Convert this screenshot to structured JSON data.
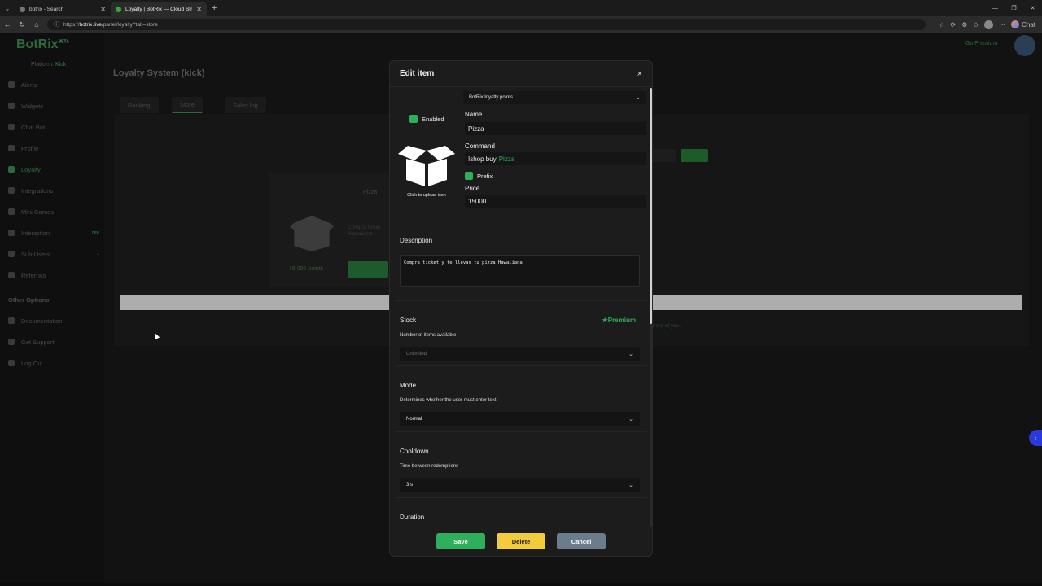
{
  "browser": {
    "tabs": [
      {
        "title": "botrix - Search",
        "active": false
      },
      {
        "title": "Loyalty | BotRix — Cloud Streaming",
        "active": true
      }
    ],
    "url_prefix": "https://",
    "url_host": "botrix.live",
    "url_path": "/panel/loyalty?tab=store",
    "chat_label": "Chat"
  },
  "sidebar": {
    "logo": "BotRix",
    "logo_tag": "BETA",
    "platform_label": "Platform:",
    "platform_value": "Kick",
    "items": [
      {
        "label": "Alerts"
      },
      {
        "label": "Widgets"
      },
      {
        "label": "Chat Bot"
      },
      {
        "label": "Profile"
      },
      {
        "label": "Loyalty",
        "active": true
      },
      {
        "label": "Integrations"
      },
      {
        "label": "Mini Games"
      },
      {
        "label": "Interaction",
        "badge": "new"
      },
      {
        "label": "Sub-Users"
      },
      {
        "label": "Referrals"
      }
    ],
    "other_section": "Other Options",
    "other_items": [
      {
        "label": "Documentation"
      },
      {
        "label": "Get Support"
      },
      {
        "label": "Log Out"
      }
    ]
  },
  "header": {
    "go_premium": "Go Premium"
  },
  "main": {
    "title": "Loyalty System (kick)",
    "tabs": [
      "Ranking",
      "Store",
      "Sales log"
    ],
    "store_item_title": "Pizza",
    "store_item_desc": "Compra ticket y te llevas tu pizza Hawaiiana",
    "store_item_points": "15,000 points",
    "filter_btn": "Filter",
    "copy_btn": "Copy",
    "note": "more of you."
  },
  "modal": {
    "title": "Edit item",
    "close": "×",
    "currency_select": "BotRix loyalty points",
    "enabled_label": "Enabled",
    "upload_label": "Click to upload icon",
    "name_label": "Name",
    "name_value": "Pizza",
    "command_label": "Command",
    "command_prefix": "!shop buy",
    "command_value": "Pizza",
    "prefix_label": "Prefix",
    "price_label": "Price",
    "price_value": "15000",
    "description_title": "Description",
    "description_value": "Compra ticket y te llevas tu pizza Hawaiiana",
    "stock_title": "Stock",
    "stock_premium": "Premium",
    "stock_sub": "Number of items available",
    "stock_value": "Unlimited",
    "mode_title": "Mode",
    "mode_sub": "Determines whether the user must enter text",
    "mode_value": "Normal",
    "cooldown_title": "Cooldown",
    "cooldown_sub": "Time between redemptions",
    "cooldown_value": "3 s",
    "duration_title": "Duration",
    "save": "Save",
    "delete": "Delete",
    "cancel": "Cancel"
  },
  "colors": {
    "accent_green": "#2eb05a",
    "delete_yellow": "#f3cc3c",
    "cancel_gray": "#6b7d8a"
  }
}
